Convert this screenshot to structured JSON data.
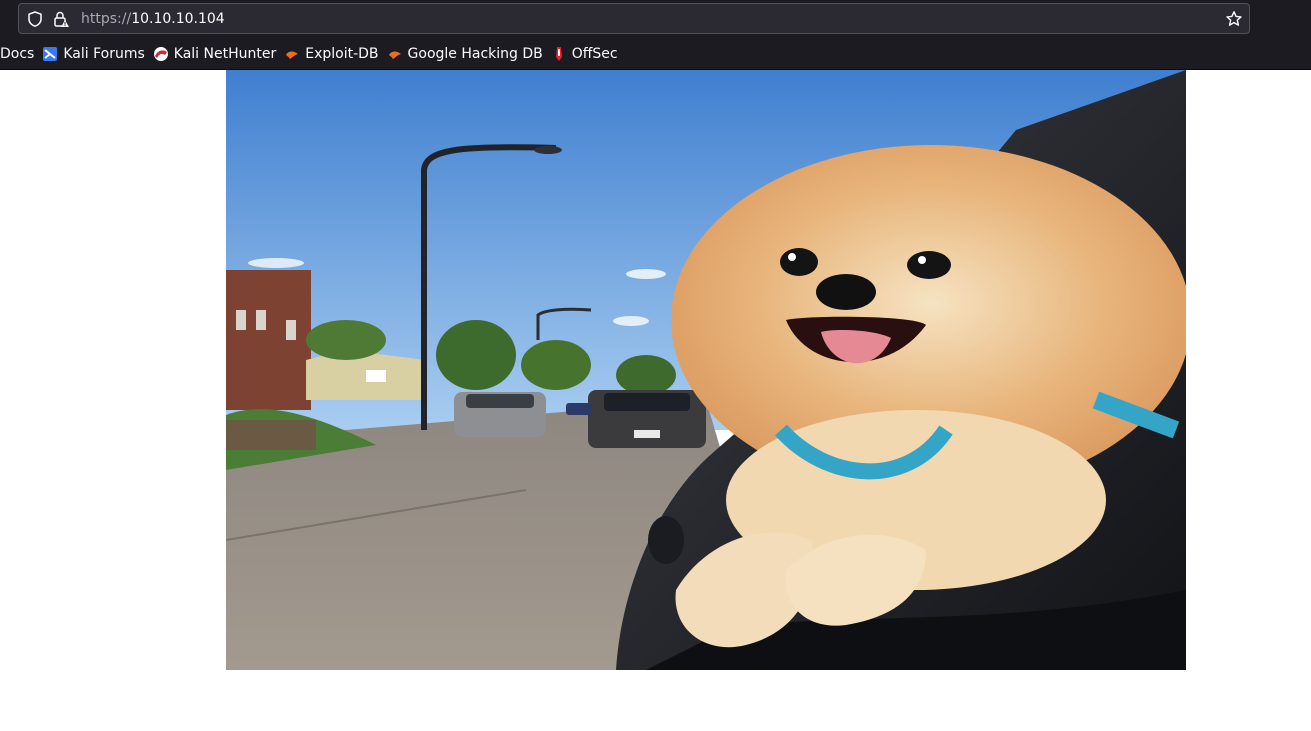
{
  "browser": {
    "url_scheme": "https://",
    "url_host": "10.10.10.104",
    "bookmarks": [
      {
        "label": "Docs",
        "icon": "docs-icon"
      },
      {
        "label": "Kali Forums",
        "icon": "kali-forums-icon"
      },
      {
        "label": "Kali NetHunter",
        "icon": "kali-nethunter-icon"
      },
      {
        "label": "Exploit-DB",
        "icon": "exploit-db-icon"
      },
      {
        "label": "Google Hacking DB",
        "icon": "google-hacking-db-icon"
      },
      {
        "label": "OffSec",
        "icon": "offsec-icon"
      }
    ],
    "icons": {
      "shield": "shield-icon",
      "lock": "lock-warning-icon",
      "star": "bookmark-star-icon"
    }
  },
  "page": {
    "image": {
      "subject": "pomeranian-dog-in-car-window",
      "icon": "photo-image"
    }
  },
  "colors": {
    "chrome_bg": "#1c1b22",
    "urlbar_bg": "#2b2a33",
    "text": "#fbfbfe",
    "page_bg": "#ffffff"
  }
}
